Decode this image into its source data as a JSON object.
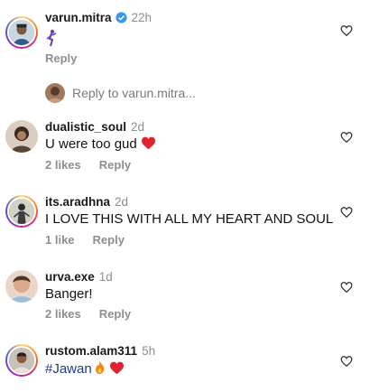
{
  "heart_color": "#e0242f",
  "verified_color": "#3897f0",
  "comments": [
    {
      "username": "varun.mitra",
      "time": "22h",
      "verified": true,
      "text": "",
      "text_emoji": "dancer",
      "likes": "",
      "reply": "Reply"
    },
    {
      "username": "dualistic_soul",
      "time": "2d",
      "text": "U were too gud",
      "text_emoji": "red-heart",
      "likes": "2 likes",
      "reply": "Reply"
    },
    {
      "username": "its.aradhna",
      "time": "2d",
      "text": "I LOVE THIS WITH ALL MY HEART AND SOUL",
      "likes": "1 like",
      "reply": "Reply"
    },
    {
      "username": "urva.exe",
      "time": "1d",
      "text": "Banger!",
      "likes": "2 likes",
      "reply": "Reply"
    },
    {
      "username": "rustom.alam311",
      "time": "5h",
      "text": "#Jawan",
      "text_emoji": "fire-and-heart",
      "likes": "",
      "reply": ""
    }
  ],
  "reply_prompt": "Reply to varun.mitra..."
}
